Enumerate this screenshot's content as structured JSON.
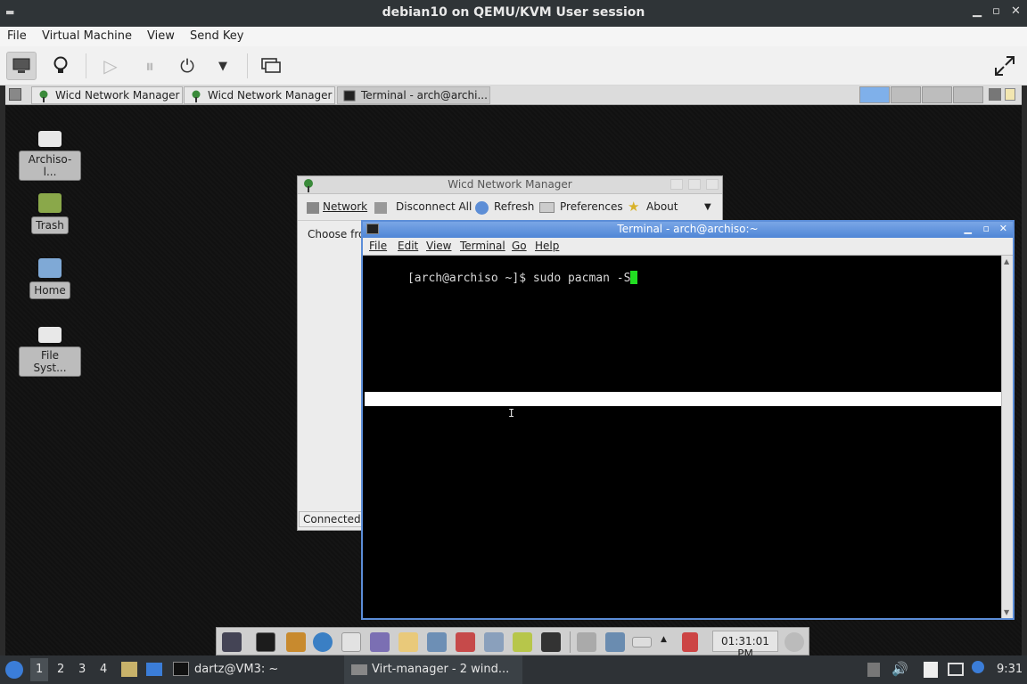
{
  "host": {
    "title": "debian10 on QEMU/KVM User session",
    "menu": [
      "File",
      "Virtual Machine",
      "View",
      "Send Key"
    ],
    "toolbar": [
      "monitor-icon",
      "lightbulb-icon",
      "play-icon",
      "pause-icon",
      "power-icon",
      "chevron-down-icon",
      "snapshots-icon",
      "fullscreen-icon"
    ]
  },
  "guest_top": {
    "tasks": [
      {
        "label": "Wicd Network Manager"
      },
      {
        "label": "Wicd Network Manager"
      },
      {
        "label": "Terminal - arch@archi..."
      }
    ]
  },
  "desktop": {
    "icons": [
      "Archiso-l...",
      "Trash",
      "Home",
      "File Syst..."
    ]
  },
  "wicd": {
    "title": "Wicd Network Manager",
    "toolbar": {
      "network": "Network",
      "disconnect": "Disconnect All",
      "refresh": "Refresh",
      "preferences": "Preferences",
      "about": "About"
    },
    "choose_text": "Choose fro",
    "status_text": "Connected t"
  },
  "terminal": {
    "title": "Terminal - arch@archiso:~",
    "menu": [
      "File",
      "Edit",
      "View",
      "Terminal",
      "Go",
      "Help"
    ],
    "prompt": "[arch@archiso ~]$ sudo pacman -S"
  },
  "dock": {
    "clock": "01:31:01 PM"
  },
  "host_panel": {
    "workspaces": [
      "1",
      "2",
      "3",
      "4"
    ],
    "task1": "dartz@VM3: ~",
    "task2": "Virt-manager - 2 wind...",
    "time": "9:31"
  },
  "colors": {
    "accent": "#5b8dd8",
    "cursor": "#22dd22",
    "host_dark": "#2f3437"
  }
}
